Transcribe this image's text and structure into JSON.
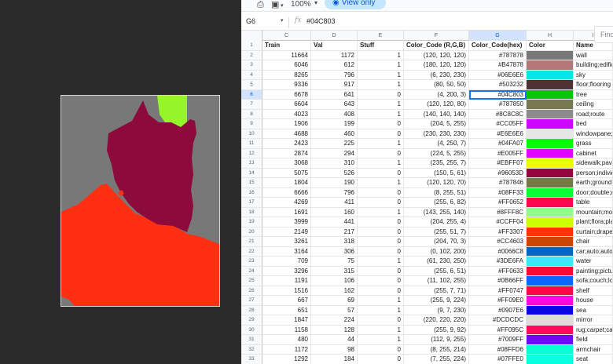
{
  "toolbar": {
    "zoom": "100%",
    "view_only_label": "View only",
    "icons": [
      "print-icon",
      "paint-format-icon",
      "eye-icon"
    ]
  },
  "formula_bar": {
    "cell_ref": "G6",
    "fx": "fx",
    "value": "#04C803"
  },
  "find_placeholder": "Find",
  "columns": [
    "C",
    "D",
    "E",
    "F",
    "G",
    "H",
    "I"
  ],
  "selected_column": "G",
  "selected_row": "6",
  "header_row": {
    "train": "Train",
    "val": "Val",
    "stuff": "Stuff",
    "color_code_rgb": "Color_Code (R,G,B)",
    "color_code_hex": "Color_Code(hex)",
    "color": "Color",
    "name": "Name"
  },
  "rows": [
    {
      "r": "2",
      "train": "11664",
      "val": "1172",
      "stuff": "1",
      "rgb": "(120, 120, 120)",
      "hex": "#787878",
      "swatch": "#787878",
      "name": "wall"
    },
    {
      "r": "3",
      "train": "6046",
      "val": "612",
      "stuff": "1",
      "rgb": "(180, 120, 120)",
      "hex": "#B47878",
      "swatch": "#B47878",
      "name": "building;edifice"
    },
    {
      "r": "4",
      "train": "8265",
      "val": "796",
      "stuff": "1",
      "rgb": "(6, 230, 230)",
      "hex": "#06E6E6",
      "swatch": "#06E6E6",
      "name": "sky"
    },
    {
      "r": "5",
      "train": "9336",
      "val": "917",
      "stuff": "1",
      "rgb": "(80, 50, 50)",
      "hex": "#503232",
      "swatch": "#503232",
      "name": "floor;flooring"
    },
    {
      "r": "6",
      "train": "6678",
      "val": "641",
      "stuff": "0",
      "rgb": "(4, 200, 3)",
      "hex": "#04C803",
      "swatch": "#04C803",
      "name": "tree"
    },
    {
      "r": "7",
      "train": "6604",
      "val": "643",
      "stuff": "1",
      "rgb": "(120, 120, 80)",
      "hex": "#787850",
      "swatch": "#787850",
      "name": "ceiling"
    },
    {
      "r": "8",
      "train": "4023",
      "val": "408",
      "stuff": "1",
      "rgb": "(140, 140, 140)",
      "hex": "#8C8C8C",
      "swatch": "#8C8C8C",
      "name": "road;route"
    },
    {
      "r": "9",
      "train": "1906",
      "val": "199",
      "stuff": "0",
      "rgb": "(204, 5, 255)",
      "hex": "#CC05FF",
      "swatch": "#CC05FF",
      "name": "bed"
    },
    {
      "r": "10",
      "train": "4688",
      "val": "460",
      "stuff": "0",
      "rgb": "(230, 230, 230)",
      "hex": "#E6E6E6",
      "swatch": "#E6E6E6",
      "name": "windowpane;w"
    },
    {
      "r": "11",
      "train": "2423",
      "val": "225",
      "stuff": "1",
      "rgb": "(4, 250, 7)",
      "hex": "#04FA07",
      "swatch": "#04FA07",
      "name": "grass"
    },
    {
      "r": "12",
      "train": "2874",
      "val": "294",
      "stuff": "0",
      "rgb": "(224, 5, 255)",
      "hex": "#E005FF",
      "swatch": "#E005FF",
      "name": "cabinet"
    },
    {
      "r": "13",
      "train": "3068",
      "val": "310",
      "stuff": "1",
      "rgb": "(235, 255, 7)",
      "hex": "#EBFF07",
      "swatch": "#EBFF07",
      "name": "sidewalk;pave"
    },
    {
      "r": "14",
      "train": "5075",
      "val": "526",
      "stuff": "0",
      "rgb": "(150, 5, 61)",
      "hex": "#96053D",
      "swatch": "#96053D",
      "name": "person;individ"
    },
    {
      "r": "15",
      "train": "1804",
      "val": "190",
      "stuff": "1",
      "rgb": "(120, 120, 70)",
      "hex": "#787846",
      "swatch": "#787846",
      "name": "earth;ground"
    },
    {
      "r": "16",
      "train": "6666",
      "val": "796",
      "stuff": "0",
      "rgb": "(8, 255, 51)",
      "hex": "#08FF33",
      "swatch": "#08FF33",
      "name": "door;double;d"
    },
    {
      "r": "17",
      "train": "4269",
      "val": "411",
      "stuff": "0",
      "rgb": "(255, 6, 82)",
      "hex": "#FF0652",
      "swatch": "#FF0652",
      "name": "table"
    },
    {
      "r": "18",
      "train": "1691",
      "val": "160",
      "stuff": "1",
      "rgb": "(143, 255, 140)",
      "hex": "#8FFF8C",
      "swatch": "#8FFF8C",
      "name": "mountain;mou"
    },
    {
      "r": "19",
      "train": "3999",
      "val": "441",
      "stuff": "0",
      "rgb": "(204, 255, 4)",
      "hex": "#CCFF04",
      "swatch": "#CCFF04",
      "name": "plant;flora;pla"
    },
    {
      "r": "20",
      "train": "2149",
      "val": "217",
      "stuff": "0",
      "rgb": "(255, 51, 7)",
      "hex": "#FF3307",
      "swatch": "#FF3307",
      "name": "curtain;drape;"
    },
    {
      "r": "21",
      "train": "3261",
      "val": "318",
      "stuff": "0",
      "rgb": "(204, 70, 3)",
      "hex": "#CC4603",
      "swatch": "#CC4603",
      "name": "chair"
    },
    {
      "r": "22",
      "train": "3164",
      "val": "306",
      "stuff": "0",
      "rgb": "(0, 102, 200)",
      "hex": "#0066C8",
      "swatch": "#0066C8",
      "name": "car;auto;auto"
    },
    {
      "r": "23",
      "train": "709",
      "val": "75",
      "stuff": "1",
      "rgb": "(61, 230, 250)",
      "hex": "#3DE6FA",
      "swatch": "#3DE6FA",
      "name": "water"
    },
    {
      "r": "24",
      "train": "3296",
      "val": "315",
      "stuff": "0",
      "rgb": "(255, 6, 51)",
      "hex": "#FF0633",
      "swatch": "#FF0633",
      "name": "painting;pictur"
    },
    {
      "r": "25",
      "train": "1191",
      "val": "106",
      "stuff": "0",
      "rgb": "(11, 102, 255)",
      "hex": "#0B66FF",
      "swatch": "#0B66FF",
      "name": "sofa;couch;lo"
    },
    {
      "r": "26",
      "train": "1516",
      "val": "162",
      "stuff": "0",
      "rgb": "(255, 7, 71)",
      "hex": "#FF0747",
      "swatch": "#FF0747",
      "name": "shelf"
    },
    {
      "r": "27",
      "train": "667",
      "val": "69",
      "stuff": "1",
      "rgb": "(255, 9, 224)",
      "hex": "#FF09E0",
      "swatch": "#FF09E0",
      "name": "house"
    },
    {
      "r": "28",
      "train": "651",
      "val": "57",
      "stuff": "1",
      "rgb": "(9, 7, 230)",
      "hex": "#0907E6",
      "swatch": "#0907E6",
      "name": "sea"
    },
    {
      "r": "29",
      "train": "1847",
      "val": "224",
      "stuff": "0",
      "rgb": "(220, 220, 220)",
      "hex": "#DCDCDC",
      "swatch": "#DCDCDC",
      "name": "mirror"
    },
    {
      "r": "30",
      "train": "1158",
      "val": "128",
      "stuff": "1",
      "rgb": "(255, 9, 92)",
      "hex": "#FF095C",
      "swatch": "#FF095C",
      "name": "rug;carpet;car"
    },
    {
      "r": "31",
      "train": "480",
      "val": "44",
      "stuff": "1",
      "rgb": "(112, 9, 255)",
      "hex": "#7009FF",
      "swatch": "#7009FF",
      "name": "field"
    },
    {
      "r": "32",
      "train": "1172",
      "val": "98",
      "stuff": "0",
      "rgb": "(8, 255, 214)",
      "hex": "#08FFD6",
      "swatch": "#08FFD6",
      "name": "armchair"
    },
    {
      "r": "33",
      "train": "1292",
      "val": "184",
      "stuff": "0",
      "rgb": "(7, 255, 224)",
      "hex": "#07FFE0",
      "swatch": "#07FFE0",
      "name": "seat"
    }
  ],
  "segmentation_colors": {
    "background": "#787878",
    "top_shape": "#96F529",
    "center_shape": "#8C0A3C",
    "bottom_shape": "#FF3012"
  }
}
